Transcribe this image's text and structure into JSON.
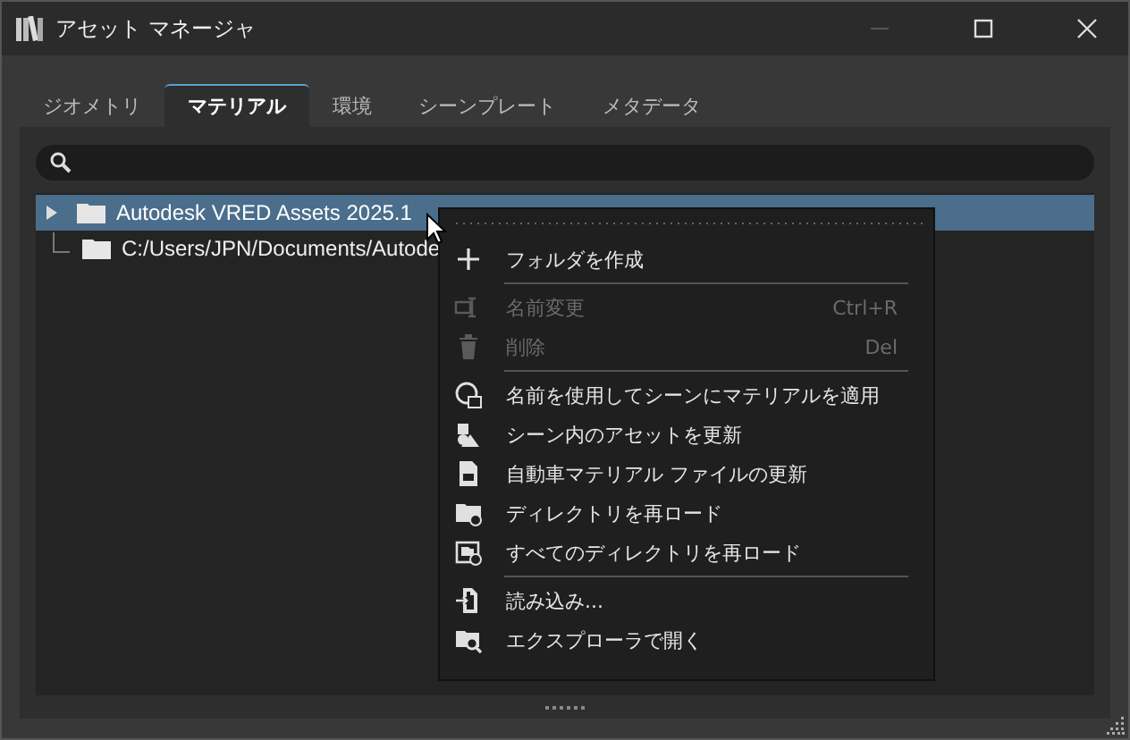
{
  "window": {
    "title": "アセット マネージャ"
  },
  "tabs": [
    {
      "label": "ジオメトリ",
      "selected": false
    },
    {
      "label": "マテリアル",
      "selected": true
    },
    {
      "label": "環境",
      "selected": false
    },
    {
      "label": "シーンプレート",
      "selected": false
    },
    {
      "label": "メタデータ",
      "selected": false
    }
  ],
  "tree": {
    "items": [
      {
        "label": "Autodesk VRED Assets 2025.1",
        "kind": "collapsed",
        "selected": true
      },
      {
        "label": "C:/Users/JPN/Documents/Autode",
        "kind": "leaf",
        "selected": false
      }
    ]
  },
  "context_menu": {
    "items": [
      {
        "kind": "item",
        "label": "フォルダを作成",
        "disabled": false
      },
      {
        "kind": "separator"
      },
      {
        "kind": "item",
        "label": "名前変更",
        "shortcut": "Ctrl+R",
        "disabled": true
      },
      {
        "kind": "item",
        "label": "削除",
        "shortcut": "Del",
        "disabled": true
      },
      {
        "kind": "separator"
      },
      {
        "kind": "item",
        "label": "名前を使用してシーンにマテリアルを適用",
        "disabled": false
      },
      {
        "kind": "item",
        "label": "シーン内のアセットを更新",
        "disabled": false
      },
      {
        "kind": "item",
        "label": "自動車マテリアル ファイルの更新",
        "disabled": false
      },
      {
        "kind": "item",
        "label": "ディレクトリを再ロード",
        "disabled": false
      },
      {
        "kind": "item",
        "label": "すべてのディレクトリを再ロード",
        "disabled": false
      },
      {
        "kind": "separator"
      },
      {
        "kind": "item",
        "label": "読み込み...",
        "disabled": false
      },
      {
        "kind": "item",
        "label": "エクスプローラで開く",
        "disabled": false
      }
    ]
  }
}
